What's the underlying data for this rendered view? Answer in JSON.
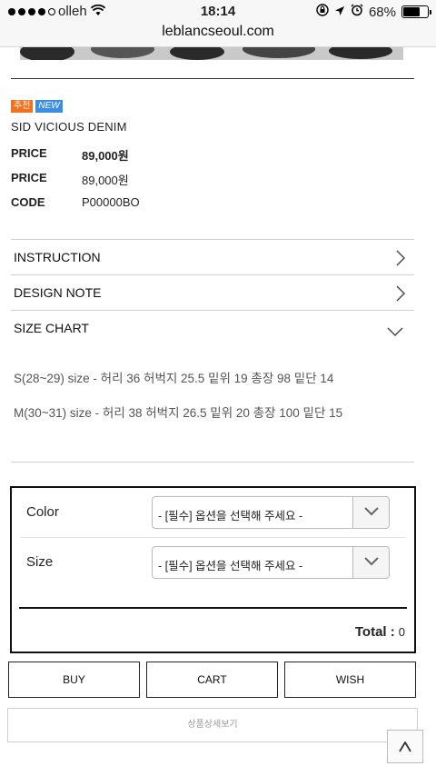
{
  "status_bar": {
    "carrier": "olleh",
    "time": "18:14",
    "battery_text": "68%",
    "battery_level": 0.68
  },
  "browser": {
    "url": "leblancseoul.com"
  },
  "product": {
    "badges": [
      "추천",
      "NEW"
    ],
    "name": "SID VICIOUS DENIM",
    "info": [
      {
        "key": "PRICE",
        "value": "89,000원"
      },
      {
        "key": "PRICE",
        "value": "89,000원"
      },
      {
        "key": "CODE",
        "value": "P00000BO"
      }
    ]
  },
  "accordion": [
    {
      "label": "INSTRUCTION",
      "icon": "chevron-right-icon"
    },
    {
      "label": "DESIGN NOTE",
      "icon": "chevron-right-icon"
    },
    {
      "label": "SIZE CHART",
      "icon": "chevron-down-icon"
    }
  ],
  "size_chart": [
    "S(28~29) size - 허리 36 허벅지 25.5 밑위 19 총장 98 밑단 14",
    "M(30~31) size - 허리 38 허벅지 26.5 밑위 20 총장 100 밑단 15"
  ],
  "options": {
    "color_label": "Color",
    "color_placeholder": "- [필수] 옵션을 선택해 주세요 -",
    "size_label": "Size",
    "size_placeholder": "- [필수] 옵션을 선택해 주세요 -",
    "total_label": "Total :",
    "total_value": "0"
  },
  "actions": {
    "buy": "BUY",
    "cart": "CART",
    "wish": "WISH",
    "detail": "상품상세보기"
  }
}
